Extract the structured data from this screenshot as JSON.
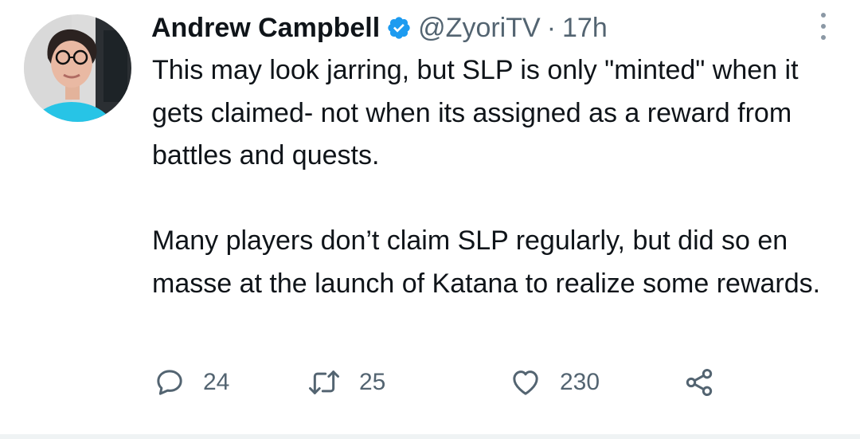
{
  "tweet": {
    "author_name": "Andrew Campbell",
    "handle": "@ZyoriTV",
    "separator": "·",
    "time": "17h",
    "verified": true,
    "paragraph1": "This may look jarring, but SLP is only \"minted\" when it gets claimed- not when its assigned as a reward from battles and quests.",
    "paragraph2": "Many players don’t claim SLP regularly, but did so en masse at the launch of Katana to realize some rewards.",
    "actions": {
      "replies": "24",
      "retweets": "25",
      "likes": "230"
    }
  },
  "icons": {
    "verified": "verified-badge-icon",
    "more": "more-vertical-icon",
    "reply": "reply-icon",
    "retweet": "retweet-icon",
    "like": "heart-icon",
    "share": "share-icon"
  },
  "colors": {
    "text": "#0f1419",
    "secondary": "#536471",
    "verified": "#1d9bf0",
    "avatar_bg": "#2b2f33",
    "shirt": "#27c4e6"
  }
}
